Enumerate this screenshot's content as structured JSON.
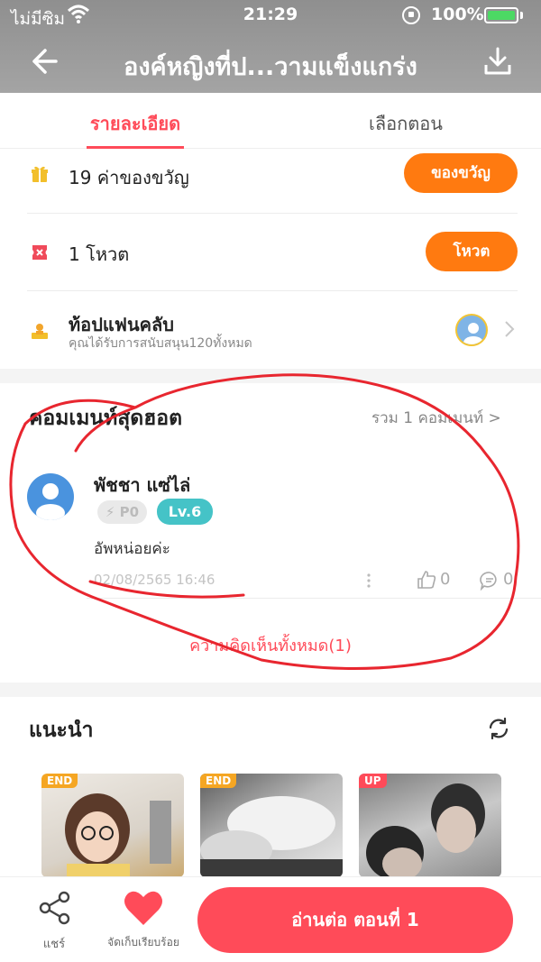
{
  "status_bar": {
    "carrier": "ไม่มีซิม",
    "time": "21:29",
    "battery": "100%",
    "battery_color": "#4cd964"
  },
  "nav": {
    "title": "องค์หญิงที่ป...วามแข็งแกร่ง",
    "back_icon": "arrow-left-icon",
    "download_icon": "download-icon"
  },
  "tabs": [
    {
      "label": "รายละเอียด",
      "active": true
    },
    {
      "label": "เลือกตอน",
      "active": false
    }
  ],
  "stats": {
    "gifts": {
      "text": "19 ค่าของขวัญ",
      "button": "ของขวัญ"
    },
    "votes": {
      "text": "1 โหวต",
      "button": "โหวต"
    },
    "fanclub": {
      "title": "ท้อปแฟนคลับ",
      "subtitle": "คุณได้รับการสนับสนุน120ทั้งหมด"
    }
  },
  "hot_comments": {
    "title": "คอมเมนท์สุดฮอต",
    "total": "รวม 1 คอมเมนท์ >",
    "comment": {
      "user": "พัชชา แซ่ไล่",
      "badge_p": "P0",
      "level": "Lv.6",
      "text": "อัพหน่อยค่ะ",
      "date": "02/08/2565 16:46",
      "likes": "0",
      "replies": "0"
    },
    "all_label": "ความคิดเห็นทั้งหมด(1)"
  },
  "recommend": {
    "title": "แนะนำ",
    "items": [
      {
        "tag": "END",
        "tag_color": "#f5a623"
      },
      {
        "tag": "END",
        "tag_color": "#f5a623"
      },
      {
        "tag": "UP",
        "tag_color": "#ff4b59"
      }
    ]
  },
  "bottom_bar": {
    "share_label": "แชร์",
    "favorite_label": "จัดเก็บเรียบร้อย",
    "read_button": "อ่านต่อ ตอนที่ 1"
  },
  "colors": {
    "accent": "#ff4b59",
    "orange": "#ff7a10",
    "level_badge": "#45c3c7"
  }
}
